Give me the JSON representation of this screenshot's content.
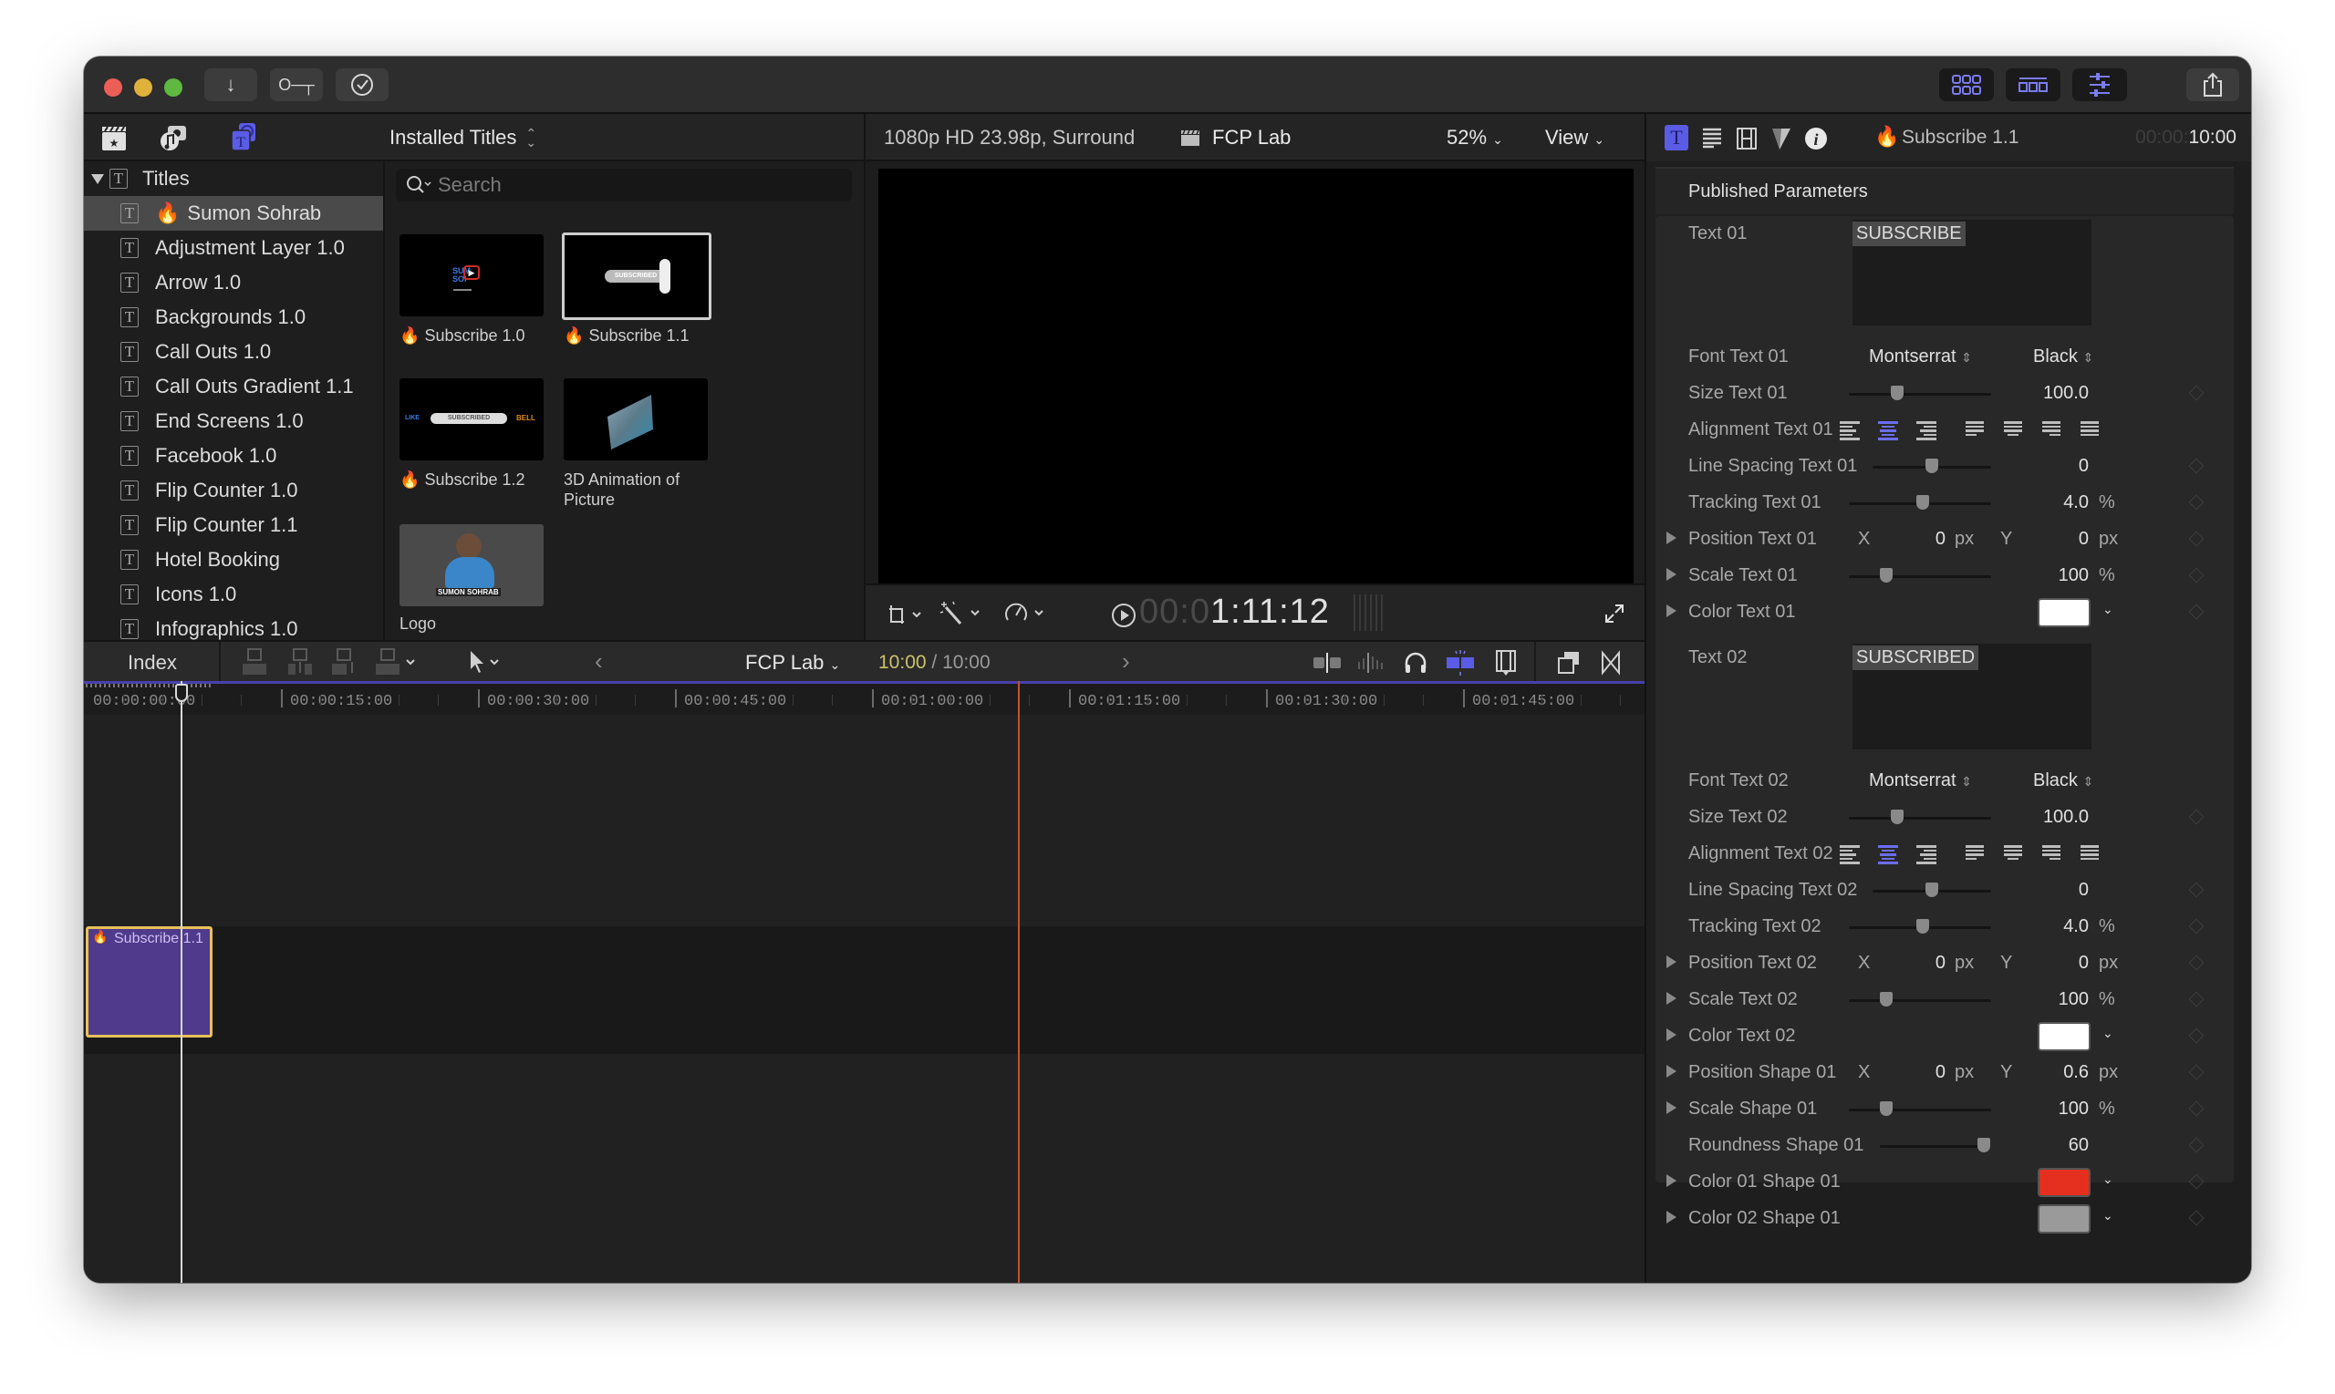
{
  "titlebar": {
    "buttons": [
      {
        "name": "import-button",
        "glyph": "↓"
      },
      {
        "name": "keywords-button",
        "glyph": "O┳"
      },
      {
        "name": "background-tasks-button",
        "glyph": "✓"
      }
    ],
    "layout_buttons": [
      "browser-toggle",
      "timeline-toggle",
      "inspector-toggle"
    ],
    "share_glyph": "⇪"
  },
  "browser": {
    "library_tabs": [
      "libraries-icon",
      "photos-audio-icon",
      "titles-generators-icon"
    ],
    "category_dropdown": "Installed Titles",
    "search_placeholder": "Search",
    "tree_root": "Titles",
    "tree_items": [
      {
        "label": "Sumon Sohrab",
        "fire": true,
        "selected": true
      },
      {
        "label": "Adjustment Layer 1.0"
      },
      {
        "label": "Arrow 1.0"
      },
      {
        "label": "Backgrounds 1.0"
      },
      {
        "label": "Call Outs 1.0"
      },
      {
        "label": "Call Outs Gradient 1.1"
      },
      {
        "label": "End Screens 1.0"
      },
      {
        "label": "Facebook 1.0"
      },
      {
        "label": "Flip Counter 1.0"
      },
      {
        "label": "Flip Counter 1.1"
      },
      {
        "label": "Hotel Booking"
      },
      {
        "label": "Icons 1.0"
      },
      {
        "label": "Infographics 1.0"
      }
    ],
    "thumbnails": [
      {
        "label": "Subscribe 1.0",
        "fire": true,
        "preview_text": "SUMON SOHRAB"
      },
      {
        "label": "Subscribe 1.1",
        "fire": true,
        "selected": true,
        "preview_text": "SUBSCRIBED"
      },
      {
        "label": "Subscribe 1.2",
        "fire": true,
        "preview_text": "SUBSCRIBED"
      },
      {
        "label": "3D Animation of Picture",
        "fire": false
      },
      {
        "label": "Logo",
        "fire": false,
        "preview_text": "SUMON SOHRAB"
      }
    ]
  },
  "viewer": {
    "format": "1080p HD 23.98p, Surround",
    "project": "FCP Lab",
    "zoom": "52%",
    "view_menu": "View",
    "timecode_dim": "00:0",
    "timecode_bright": "1:11:12"
  },
  "timeline": {
    "index_label": "Index",
    "project": "FCP Lab",
    "duration_current": "10:00",
    "duration_sep": " / ",
    "duration_total": "10:00",
    "ruler": [
      "00:00:00:00",
      "00:00:15:00",
      "00:00:30:00",
      "00:00:45:00",
      "00:01:00:00",
      "00:01:15:00",
      "00:01:30:00",
      "00:01:45:00"
    ],
    "clip": {
      "label": "Subscribe 1.1",
      "color": "#4f3a8c",
      "border": "#e8c15a"
    },
    "playhead_color": "#d9d9d9",
    "skimmer_color": "#c2522e"
  },
  "inspector": {
    "tabs": [
      "title-inspector",
      "text-inspector",
      "video-inspector",
      "color-inspector",
      "info-inspector"
    ],
    "clip_name": "Subscribe 1.1",
    "duration_dim": "00:00:",
    "duration_bright": "10:00",
    "section": "Published Parameters",
    "text01": {
      "label": "Text 01",
      "value": "SUBSCRIBE"
    },
    "text02": {
      "label": "Text 02",
      "value": "SUBSCRIBED"
    },
    "rows1": [
      {
        "label": "Font Text 01",
        "type": "font",
        "family": "Montserrat",
        "weight": "Black"
      },
      {
        "label": "Size Text 01",
        "type": "slider",
        "value": "100.0",
        "pos": 0.34
      },
      {
        "label": "Alignment Text 01",
        "type": "align",
        "selected": 1
      },
      {
        "label": "Line Spacing Text 01",
        "type": "slider2",
        "value": "0",
        "pos": 0.5
      },
      {
        "label": "Tracking Text 01",
        "type": "slider",
        "value": "4.0",
        "unit": "%",
        "pos": 0.52
      },
      {
        "label": "Position Text 01",
        "type": "xy",
        "x": "0",
        "y": "0",
        "unit": "px",
        "expand": true
      },
      {
        "label": "Scale Text 01",
        "type": "slider",
        "value": "100",
        "unit": "%",
        "pos": 0.26,
        "expand": true
      },
      {
        "label": "Color Text 01",
        "type": "color",
        "color": "#ffffff",
        "expand": true
      }
    ],
    "rows2": [
      {
        "label": "Font Text 02",
        "type": "font",
        "family": "Montserrat",
        "weight": "Black"
      },
      {
        "label": "Size Text 02",
        "type": "slider",
        "value": "100.0",
        "pos": 0.34
      },
      {
        "label": "Alignment Text 02",
        "type": "align",
        "selected": 1
      },
      {
        "label": "Line Spacing Text 02",
        "type": "slider2",
        "value": "0",
        "pos": 0.5
      },
      {
        "label": "Tracking Text 02",
        "type": "slider",
        "value": "4.0",
        "unit": "%",
        "pos": 0.52
      },
      {
        "label": "Position Text 02",
        "type": "xy",
        "x": "0",
        "y": "0",
        "unit": "px",
        "expand": true
      },
      {
        "label": "Scale Text 02",
        "type": "slider",
        "value": "100",
        "unit": "%",
        "pos": 0.26,
        "expand": true
      },
      {
        "label": "Color Text 02",
        "type": "color",
        "color": "#ffffff",
        "expand": true
      },
      {
        "label": "Position Shape 01",
        "type": "xy",
        "x": "0",
        "y": "0.6",
        "unit": "px",
        "expand": true
      },
      {
        "label": "Scale Shape 01",
        "type": "slider",
        "value": "100",
        "unit": "%",
        "pos": 0.26,
        "expand": true
      },
      {
        "label": "Roundness Shape 01",
        "type": "slider3",
        "value": "60",
        "pos": 0.95
      },
      {
        "label": "Color 01 Shape 01",
        "type": "color",
        "color": "#e5301f",
        "expand": true
      },
      {
        "label": "Color 02 Shape 01",
        "type": "color",
        "color": "#9a9a9a",
        "expand": true
      }
    ]
  },
  "colors": {
    "accent": "#5a5ce6",
    "accent_text": "#7b7cf0"
  }
}
